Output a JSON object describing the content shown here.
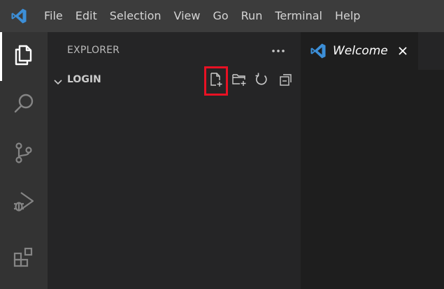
{
  "menu": [
    "File",
    "Edit",
    "Selection",
    "View",
    "Go",
    "Run",
    "Terminal",
    "Help"
  ],
  "activity_bar": {
    "items": [
      {
        "name": "explorer",
        "icon": "files-icon",
        "active": true
      },
      {
        "name": "search",
        "icon": "search-icon"
      },
      {
        "name": "source-control",
        "icon": "source-control-icon"
      },
      {
        "name": "run-debug",
        "icon": "run-debug-icon"
      },
      {
        "name": "extensions",
        "icon": "extensions-icon"
      }
    ]
  },
  "sidebar": {
    "header": "EXPLORER",
    "section_title": "LOGIN",
    "actions": [
      {
        "name": "new-file",
        "icon": "new-file-icon",
        "highlighted": true
      },
      {
        "name": "new-folder",
        "icon": "new-folder-icon"
      },
      {
        "name": "refresh",
        "icon": "refresh-icon"
      },
      {
        "name": "collapse-all",
        "icon": "collapse-all-icon"
      }
    ]
  },
  "editor": {
    "tab_label": "Welcome"
  },
  "colors": {
    "accent": "#3c8fd8",
    "highlight": "#e81123",
    "menubar": "#3c3c3c",
    "activitybar": "#333333",
    "sidebar": "#252526",
    "editor": "#1e1e1e"
  }
}
